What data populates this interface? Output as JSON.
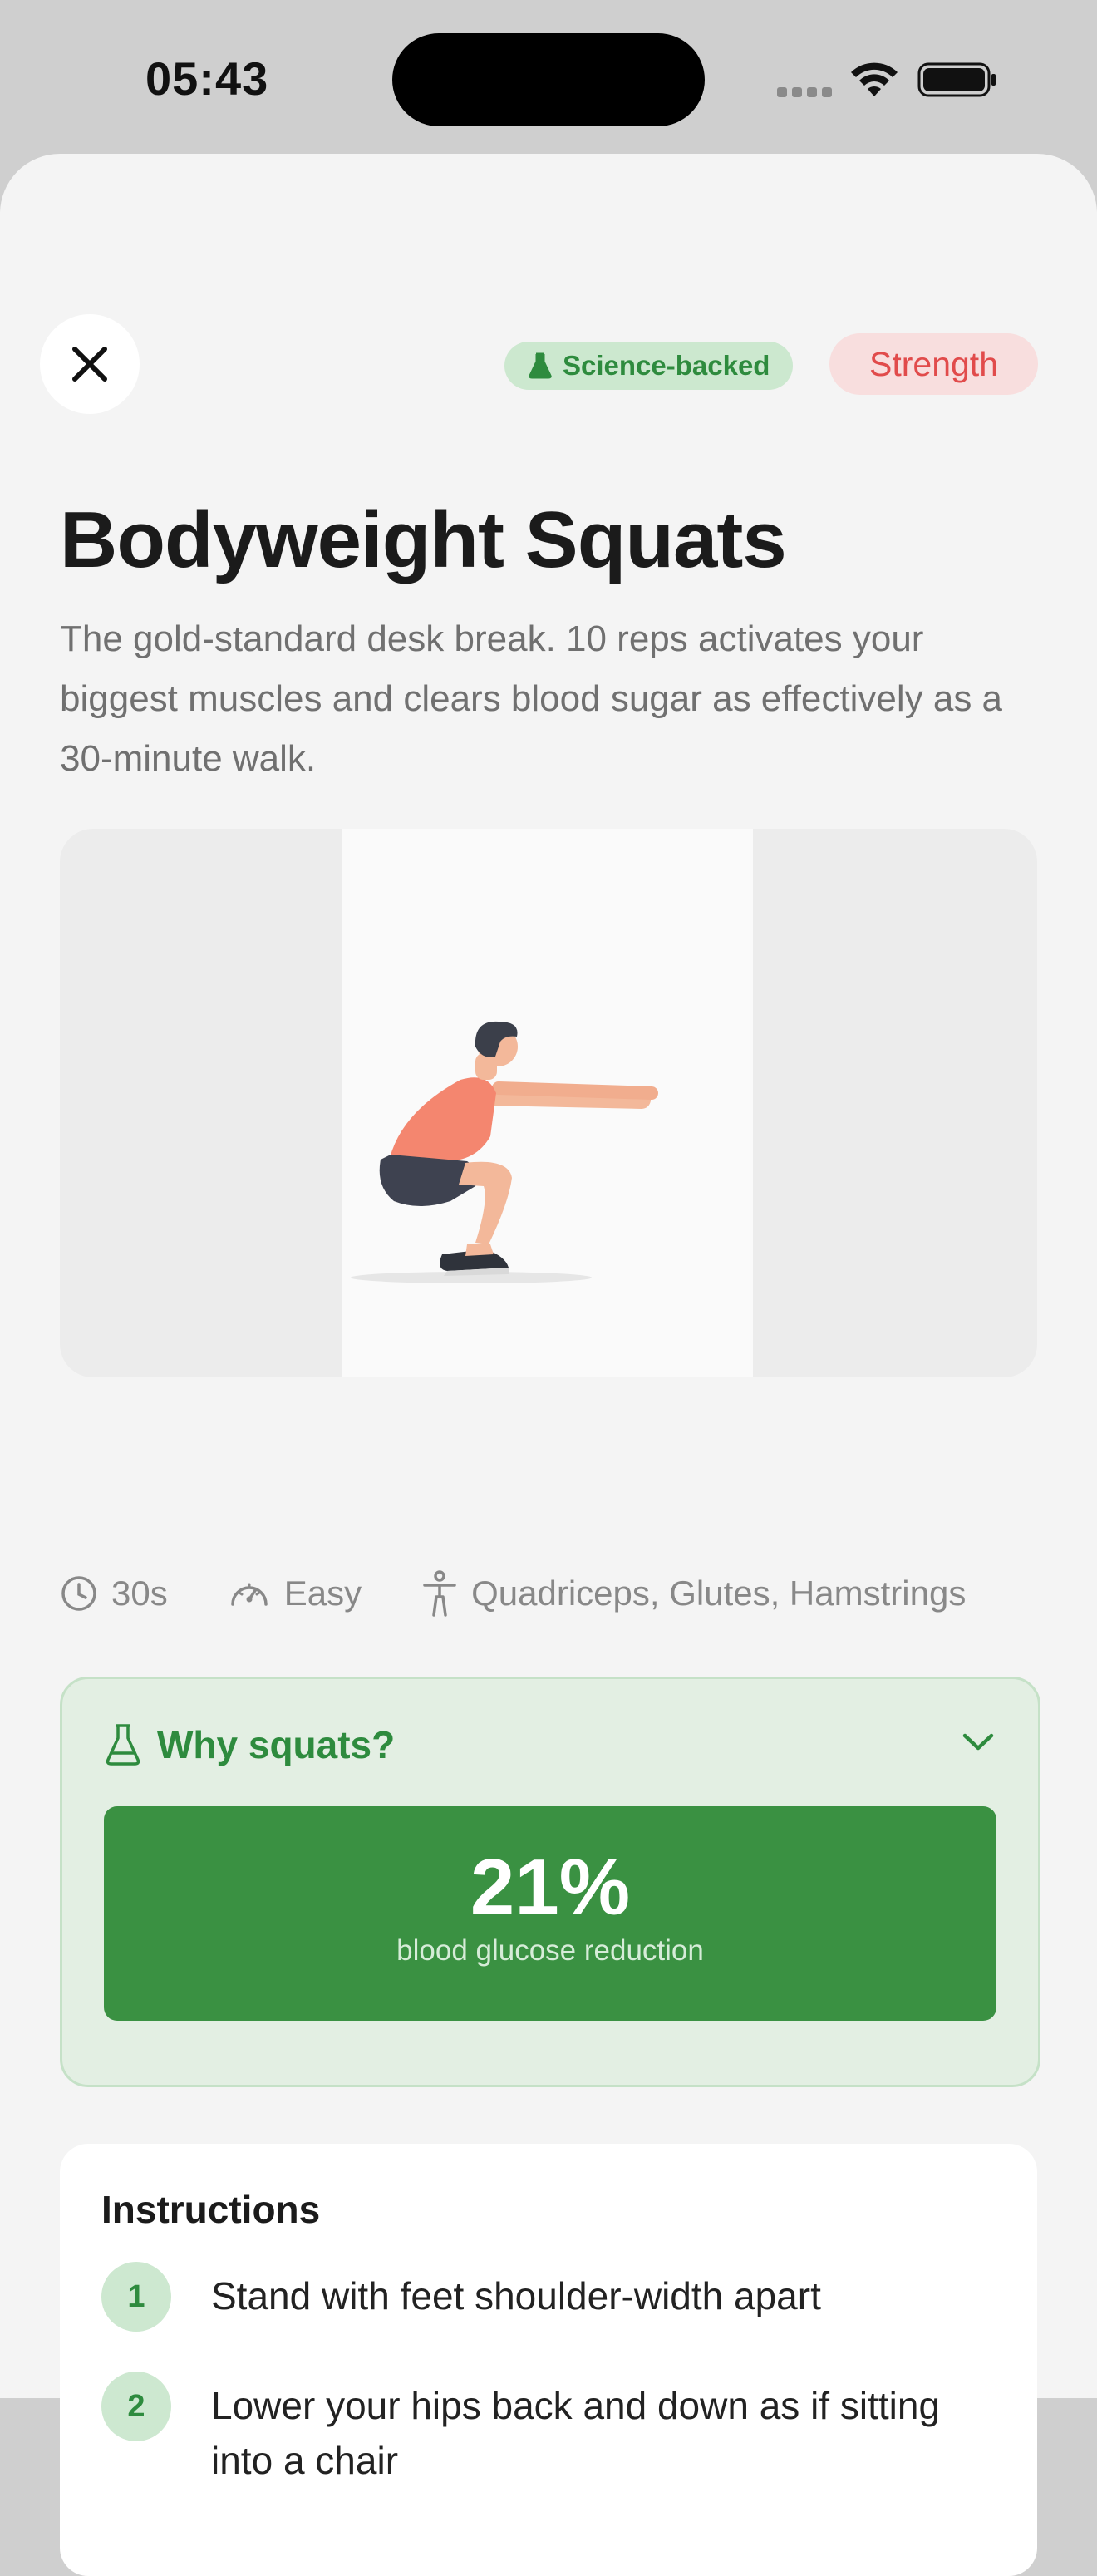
{
  "status_bar": {
    "time": "05:43"
  },
  "header": {
    "badge_science": "Science-backed",
    "badge_category": "Strength",
    "colors": {
      "science_bg": "#cce8cf",
      "science_fg": "#2e8b3e",
      "category_bg": "#f8dede",
      "category_fg": "#e14b4b"
    }
  },
  "exercise": {
    "title": "Bodyweight Squats",
    "description": "The gold-standard desk break. 10 reps activates your biggest muscles and clears blood sugar as effectively as a 30-minute walk."
  },
  "meta": {
    "duration": "30s",
    "difficulty": "Easy",
    "muscles": "Quadriceps, Glutes, Hamstrings"
  },
  "why": {
    "heading": "Why squats?",
    "stat_value": "21%",
    "stat_label": "blood glucose reduction",
    "accent": "#3a9142"
  },
  "instructions": {
    "heading": "Instructions",
    "steps": [
      {
        "number": "1",
        "text": "Stand with feet shoulder-width apart"
      },
      {
        "number": "2",
        "text": "Lower your hips back and down as if sitting into a chair"
      }
    ]
  }
}
